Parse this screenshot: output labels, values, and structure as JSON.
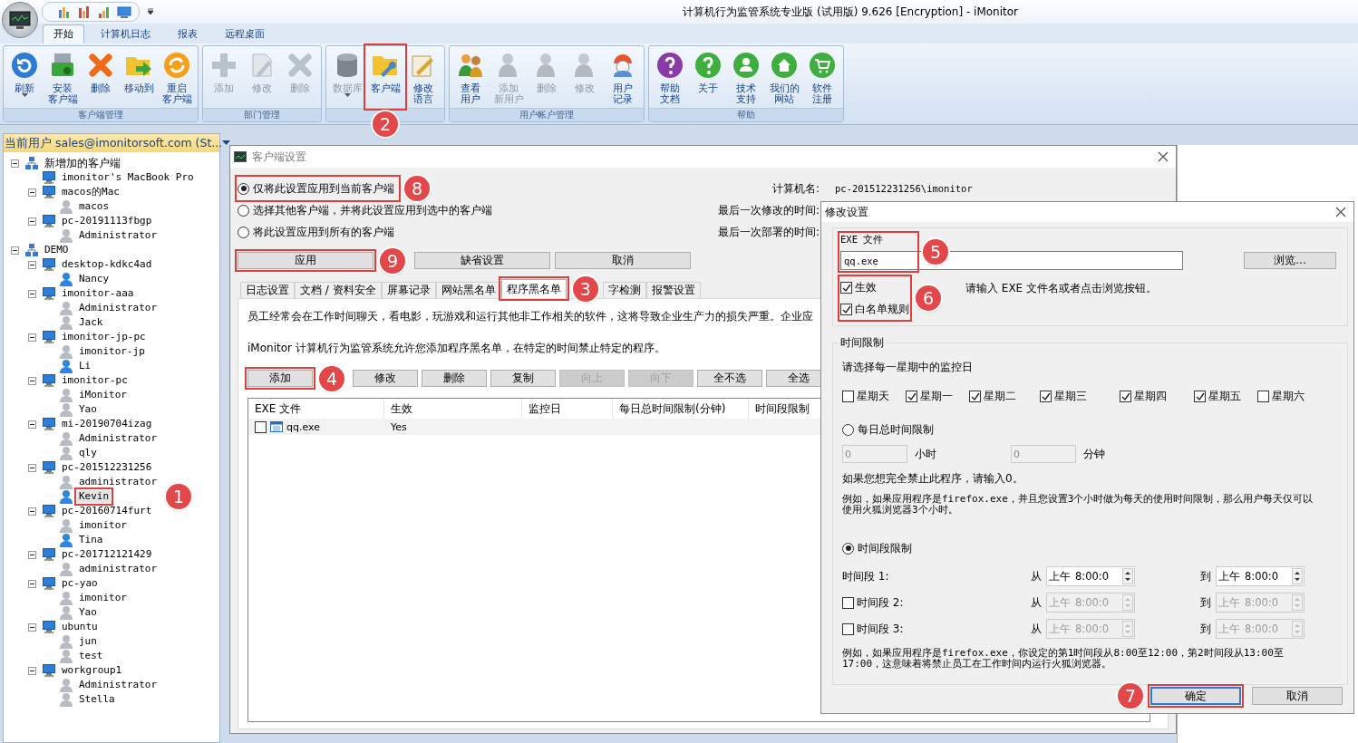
{
  "window": {
    "title": "计算机行为监管系统专业版 (试用版) 9.626 [Encryption] - iMonitor"
  },
  "ribbon_tabs": [
    {
      "label": "开始",
      "selected": true
    },
    {
      "label": "计算机日志",
      "selected": false
    },
    {
      "label": "报表",
      "selected": false
    },
    {
      "label": "远程桌面",
      "selected": false
    }
  ],
  "ribbon_groups": [
    {
      "label": "客户端管理",
      "buttons": [
        {
          "lines": [
            "刷新"
          ],
          "kind": "refresh",
          "disabled": false,
          "dropdown": true
        },
        {
          "lines": [
            "安装",
            "客户端"
          ],
          "kind": "install",
          "disabled": false
        },
        {
          "lines": [
            "删除"
          ],
          "kind": "delete",
          "disabled": false
        },
        {
          "lines": [
            "移动到"
          ],
          "kind": "move",
          "disabled": false
        },
        {
          "lines": [
            "重启",
            "客户端"
          ],
          "kind": "restart",
          "disabled": false
        }
      ]
    },
    {
      "label": "部门管理",
      "buttons": [
        {
          "lines": [
            "添加"
          ],
          "kind": "add",
          "disabled": true
        },
        {
          "lines": [
            "修改"
          ],
          "kind": "edit",
          "disabled": true
        },
        {
          "lines": [
            "删除"
          ],
          "kind": "remove",
          "disabled": true
        }
      ]
    },
    {
      "buttons": [
        {
          "lines": [
            "数据库"
          ],
          "kind": "database",
          "disabled": true,
          "dropdown": true
        },
        {
          "lines": [
            "客户端"
          ],
          "kind": "client",
          "disabled": false,
          "callout": "2"
        },
        {
          "lines": [
            "修改",
            "语言"
          ],
          "kind": "language",
          "disabled": false
        }
      ]
    },
    {
      "label": "用户帐户管理",
      "buttons": [
        {
          "lines": [
            "查看",
            "用户"
          ],
          "kind": "users",
          "disabled": false
        },
        {
          "lines": [
            "添加",
            "新用户"
          ],
          "kind": "user",
          "disabled": true
        },
        {
          "lines": [
            "删除"
          ],
          "kind": "user",
          "disabled": true
        },
        {
          "lines": [
            "修改"
          ],
          "kind": "user",
          "disabled": true
        },
        {
          "lines": [
            "用户",
            "记录"
          ],
          "kind": "log",
          "disabled": false
        }
      ]
    },
    {
      "label": "帮助",
      "buttons": [
        {
          "lines": [
            "帮助",
            "文档"
          ],
          "kind": "help",
          "disabled": false
        },
        {
          "lines": [
            "关于"
          ],
          "kind": "about",
          "disabled": false
        },
        {
          "lines": [
            "技术",
            "支持"
          ],
          "kind": "support",
          "disabled": false
        },
        {
          "lines": [
            "我们的",
            "网站"
          ],
          "kind": "website",
          "disabled": false
        },
        {
          "lines": [
            "软件",
            "注册"
          ],
          "kind": "register",
          "disabled": false
        }
      ]
    }
  ],
  "user_bar": {
    "text": "当前用户 sales@imonitorsoft.com (St..."
  },
  "tree": [
    {
      "label": "新增加的客户端",
      "kind": "group",
      "selected": false,
      "expanded": true,
      "children": [
        {
          "label": "imonitor's MacBook Pro",
          "kind": "computer",
          "selected": false
        },
        {
          "label": "macos的Mac",
          "kind": "computer",
          "selected": false,
          "expanded": true,
          "children": [
            {
              "label": "macos",
              "kind": "user",
              "online": false,
              "selected": false
            }
          ]
        },
        {
          "label": "pc-20191113fbgp",
          "kind": "computer",
          "selected": false,
          "expanded": true,
          "children": [
            {
              "label": "Administrator",
              "kind": "user",
              "online": false,
              "selected": false
            }
          ]
        }
      ]
    },
    {
      "label": "DEMO",
      "kind": "group",
      "selected": false,
      "expanded": true,
      "children": [
        {
          "label": "desktop-kdkc4ad",
          "kind": "computer",
          "selected": false,
          "expanded": true,
          "children": [
            {
              "label": "Nancy",
              "kind": "user",
              "online": true,
              "selected": false
            }
          ]
        },
        {
          "label": "imonitor-aaa",
          "kind": "computer",
          "selected": false,
          "expanded": true,
          "children": [
            {
              "label": "Administrator",
              "kind": "user",
              "online": false,
              "selected": false
            },
            {
              "label": "Jack",
              "kind": "user",
              "online": false,
              "selected": false
            }
          ]
        },
        {
          "label": "imonitor-jp-pc",
          "kind": "computer",
          "selected": false,
          "expanded": true,
          "children": [
            {
              "label": "imonitor-jp",
              "kind": "user",
              "online": false,
              "selected": false
            },
            {
              "label": "Li",
              "kind": "user",
              "online": true,
              "selected": false
            }
          ]
        },
        {
          "label": "imonitor-pc",
          "kind": "computer",
          "selected": false,
          "expanded": true,
          "children": [
            {
              "label": "iMonitor",
              "kind": "user",
              "online": false,
              "selected": false
            },
            {
              "label": "Yao",
              "kind": "user",
              "online": false,
              "selected": false
            }
          ]
        },
        {
          "label": "mi-20190704izag",
          "kind": "computer",
          "selected": false,
          "expanded": true,
          "children": [
            {
              "label": "Administrator",
              "kind": "user",
              "online": false,
              "selected": false
            },
            {
              "label": "qly",
              "kind": "user",
              "online": false,
              "selected": false
            }
          ]
        },
        {
          "label": "pc-201512231256",
          "kind": "computer",
          "selected": false,
          "expanded": true,
          "children": [
            {
              "label": "administrator",
              "kind": "user",
              "online": false,
              "selected": false
            },
            {
              "label": "Kevin",
              "kind": "user",
              "online": true,
              "selected": true,
              "callout": "1"
            }
          ]
        },
        {
          "label": "pc-20160714furt",
          "kind": "computer",
          "selected": false,
          "expanded": true,
          "children": [
            {
              "label": "imonitor",
              "kind": "user",
              "online": false,
              "selected": false
            },
            {
              "label": "Tina",
              "kind": "user",
              "online": true,
              "selected": false
            }
          ]
        },
        {
          "label": "pc-201712121429",
          "kind": "computer",
          "selected": false,
          "expanded": true,
          "children": [
            {
              "label": "administrator",
              "kind": "user",
              "online": false,
              "selected": false
            }
          ]
        },
        {
          "label": "pc-yao",
          "kind": "computer",
          "selected": false,
          "expanded": true,
          "children": [
            {
              "label": "imonitor",
              "kind": "user",
              "online": false,
              "selected": false
            },
            {
              "label": "Yao",
              "kind": "user",
              "online": false,
              "selected": false
            }
          ]
        },
        {
          "label": "ubuntu",
          "kind": "computer",
          "selected": false,
          "expanded": true,
          "children": [
            {
              "label": "jun",
              "kind": "user",
              "online": false,
              "selected": false
            },
            {
              "label": "test",
              "kind": "user",
              "online": false,
              "selected": false
            }
          ]
        },
        {
          "label": "workgroup1",
          "kind": "computer",
          "selected": false,
          "expanded": true,
          "children": [
            {
              "label": "Administrator",
              "kind": "user",
              "online": false,
              "selected": false
            },
            {
              "label": "Stella",
              "kind": "user",
              "online": false,
              "selected": false
            }
          ]
        }
      ]
    }
  ],
  "client_settings": {
    "title": "客户端设置",
    "scope_options": [
      {
        "label": "仅将此设置应用到当前客户端",
        "selected": true,
        "callout": "8"
      },
      {
        "label": "选择其他客户端，并将此设置应用到选中的客户端",
        "selected": false
      },
      {
        "label": "将此设置应用到所有的客户端",
        "selected": false
      }
    ],
    "info": [
      {
        "label": "计算机名:",
        "value": "pc-201512231256\\imonitor"
      },
      {
        "label": "最后一次修改的时间:"
      },
      {
        "label": "最后一次部署的时间:"
      }
    ],
    "actions": [
      {
        "label": "应用",
        "callout": "9"
      },
      {
        "label": "缺省设置"
      },
      {
        "label": "取消"
      }
    ],
    "tabs": [
      {
        "label": "日志设置",
        "selected": false
      },
      {
        "label": "文档 / 资料安全",
        "selected": false
      },
      {
        "label": "屏幕记录",
        "selected": false
      },
      {
        "label": "网站黑名单",
        "selected": false
      },
      {
        "label": "程序黑名单",
        "selected": true,
        "callout": "3"
      },
      {
        "label": "字检测",
        "selected": false
      },
      {
        "label": "报警设置",
        "selected": false
      }
    ],
    "description": "员工经常会在工作时间聊天，看电影，玩游戏和运行其他非工作相关的软件，这将导致企业生产力的损失严重。企业应",
    "note": "iMonitor 计算机行为监管系统允许您添加程序黑名单，在特定的时间禁止特定的程序。",
    "list_buttons": [
      {
        "label": "添加",
        "disabled": false,
        "callout": "4"
      },
      {
        "label": "修改",
        "disabled": false
      },
      {
        "label": "删除",
        "disabled": false
      },
      {
        "label": "复制",
        "disabled": false
      },
      {
        "label": "向上",
        "disabled": true
      },
      {
        "label": "向下",
        "disabled": true
      },
      {
        "label": "全不选",
        "disabled": false
      },
      {
        "label": "全选",
        "disabled": false
      }
    ],
    "table": {
      "columns": [
        "EXE 文件",
        "生效",
        "监控日",
        "每日总时间限制(分钟)",
        "时间段限制"
      ],
      "rows": [
        {
          "checked": false,
          "cells": [
            "qq.exe",
            "Yes"
          ]
        }
      ]
    }
  },
  "modify_dialog": {
    "title": "修改设置",
    "exe_label": "EXE 文件",
    "exe_value": "qq.exe",
    "exe_callout": "5",
    "browse": "浏览...",
    "options": [
      {
        "label": "生效",
        "checked": true
      },
      {
        "label": "白名单规则",
        "checked": true
      }
    ],
    "options_callout": "6",
    "hint": "请输入 EXE 文件名或者点击浏览按钮。",
    "time_group": {
      "title": "时间限制",
      "prompt": "请选择每一星期中的监控日",
      "days": [
        {
          "label": "星期天",
          "checked": false
        },
        {
          "label": "星期一",
          "checked": true
        },
        {
          "label": "星期二",
          "checked": true
        },
        {
          "label": "星期三",
          "checked": true
        },
        {
          "label": "星期四",
          "checked": true
        },
        {
          "label": "星期五",
          "checked": true
        },
        {
          "label": "星期六",
          "checked": false
        }
      ],
      "daily_limit": {
        "label": "每日总时间限制",
        "selected": false,
        "disabled": true,
        "hours": "0",
        "hours_unit": "小时",
        "minutes": "0",
        "minutes_unit": "分钟"
      },
      "zero_hint": "如果您想完全禁止此程序，请输入0。",
      "daily_example": "例如，如果应用程序是firefox.exe，并且您设置3个小时做为每天的使用时间限制，那么用户每天仅可以使用火狐浏览器3个小时。",
      "period_limit": {
        "label": "时间段限制",
        "selected": true
      },
      "periods": [
        {
          "label": "时间段 1:",
          "kind": "label",
          "disabled": false,
          "from_label": "从",
          "from_ampm": "上午",
          "from_time": "8:00:0",
          "to_label": "到",
          "to_ampm": "上午",
          "to_time": "8:00:0"
        },
        {
          "label": "时间段 2:",
          "kind": "checkbox",
          "checked": false,
          "disabled": true,
          "from_label": "从",
          "from_ampm": "上午",
          "from_time": "8:00:0",
          "to_label": "到",
          "to_ampm": "上午",
          "to_time": "8:00:0"
        },
        {
          "label": "时间段 3:",
          "kind": "checkbox",
          "checked": false,
          "disabled": true,
          "from_label": "从",
          "from_ampm": "上午",
          "from_time": "8:00:0",
          "to_label": "到",
          "to_ampm": "上午",
          "to_time": "8:00:0"
        }
      ],
      "period_example": "例如，如果应用程序是firefox.exe，你设定的第1时间段从8:00至12:00，第2时间段从13:00至17:00，这意味着将禁止员工在工作时间内运行火狐浏览器。"
    },
    "buttons": [
      {
        "label": "确定",
        "kind": "default",
        "callout": "7"
      },
      {
        "label": "取消",
        "kind": "normal"
      }
    ]
  }
}
